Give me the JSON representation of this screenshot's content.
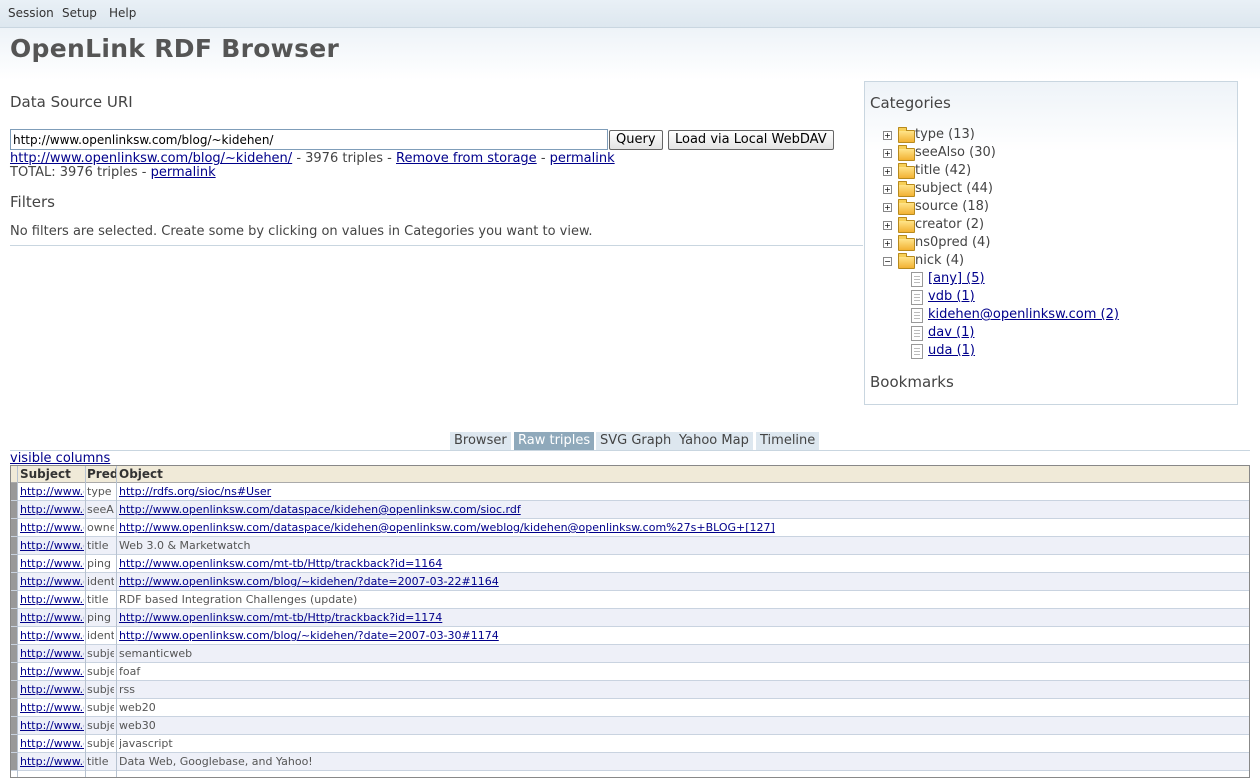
{
  "menu": [
    "Session",
    "Setup",
    "Help"
  ],
  "app_title": "OpenLink RDF Browser",
  "data_source": {
    "title": "Data Source URI",
    "uri_value": "http://www.openlinksw.com/blog/~kidehen/",
    "query_label": "Query",
    "webdav_label": "Load via Local WebDAV",
    "source_link": "http://www.openlinksw.com/blog/~kidehen/",
    "source_triples": " - 3976 triples - ",
    "remove_label": "Remove from storage",
    "sep": " - ",
    "permalink_label": "permalink",
    "total_text": "TOTAL: 3976 triples - ",
    "total_permalink": "permalink"
  },
  "filters": {
    "title": "Filters",
    "empty_text": "No filters are selected. Create some by clicking on values in Categories you want to view."
  },
  "categories": {
    "title": "Categories",
    "items": [
      "type (13)",
      "seeAlso (30)",
      "title (42)",
      "subject (44)",
      "source (18)",
      "creator (2)",
      "ns0pred (4)",
      "nick (4)"
    ],
    "nick_values": [
      "[any] (5)",
      "vdb (1)",
      "kidehen@openlinksw.com (2)",
      "dav (1)",
      "uda (1)"
    ],
    "bookmarks_title": "Bookmarks"
  },
  "tabs": [
    "Browser",
    "Raw triples",
    "SVG Graph",
    "Yahoo Map",
    "Timeline"
  ],
  "active_tab": "Raw triples",
  "visible_columns_label": "visible columns",
  "grid": {
    "headers": [
      "Subject",
      "Predi",
      "Object"
    ],
    "rows": [
      {
        "subject": "http://www.openlinksw.com",
        "predicate": "type",
        "object": "http://rdfs.org/sioc/ns#User",
        "object_is_link": true
      },
      {
        "subject": "http://www.openlinksw.com",
        "predicate": "seeAlso",
        "object": "http://www.openlinksw.com/dataspace/kidehen@openlinksw.com/sioc.rdf",
        "object_is_link": true
      },
      {
        "subject": "http://www.openlinksw.com",
        "predicate": "owner",
        "object": "http://www.openlinksw.com/dataspace/kidehen@openlinksw.com/weblog/kidehen@openlinksw.com%27s+BLOG+[127]",
        "object_is_link": true
      },
      {
        "subject": "http://www.openlinksw.com",
        "predicate": "title",
        "object": "Web 3.0 & Marketwatch",
        "object_is_link": false
      },
      {
        "subject": "http://www.openlinksw.com",
        "predicate": "ping",
        "object": "http://www.openlinksw.com/mt-tb/Http/trackback?id=1164",
        "object_is_link": true
      },
      {
        "subject": "http://www.openlinksw.com",
        "predicate": "identifier",
        "object": "http://www.openlinksw.com/blog/~kidehen/?date=2007-03-22#1164",
        "object_is_link": true
      },
      {
        "subject": "http://www.openlinksw.com",
        "predicate": "title",
        "object": "RDF based Integration Challenges (update)",
        "object_is_link": false
      },
      {
        "subject": "http://www.openlinksw.com",
        "predicate": "ping",
        "object": "http://www.openlinksw.com/mt-tb/Http/trackback?id=1174",
        "object_is_link": true
      },
      {
        "subject": "http://www.openlinksw.com",
        "predicate": "identifier",
        "object": "http://www.openlinksw.com/blog/~kidehen/?date=2007-03-30#1174",
        "object_is_link": true
      },
      {
        "subject": "http://www.openlinksw.com",
        "predicate": "subject",
        "object": "semanticweb",
        "object_is_link": false
      },
      {
        "subject": "http://www.openlinksw.com",
        "predicate": "subject",
        "object": "foaf",
        "object_is_link": false
      },
      {
        "subject": "http://www.openlinksw.com",
        "predicate": "subject",
        "object": "rss",
        "object_is_link": false
      },
      {
        "subject": "http://www.openlinksw.com",
        "predicate": "subject",
        "object": "web20",
        "object_is_link": false
      },
      {
        "subject": "http://www.openlinksw.com",
        "predicate": "subject",
        "object": "web30",
        "object_is_link": false
      },
      {
        "subject": "http://www.openlinksw.com",
        "predicate": "subject",
        "object": "javascript",
        "object_is_link": false
      },
      {
        "subject": "http://www.openlinksw.com",
        "predicate": "title",
        "object": "Data Web, Googlebase, and Yahoo!",
        "object_is_link": false
      }
    ]
  },
  "colors": {
    "tab_active": "#8fa9bb",
    "tab": "#dde7ef",
    "link": "#00008b",
    "header_bg": "#f0ead8"
  }
}
